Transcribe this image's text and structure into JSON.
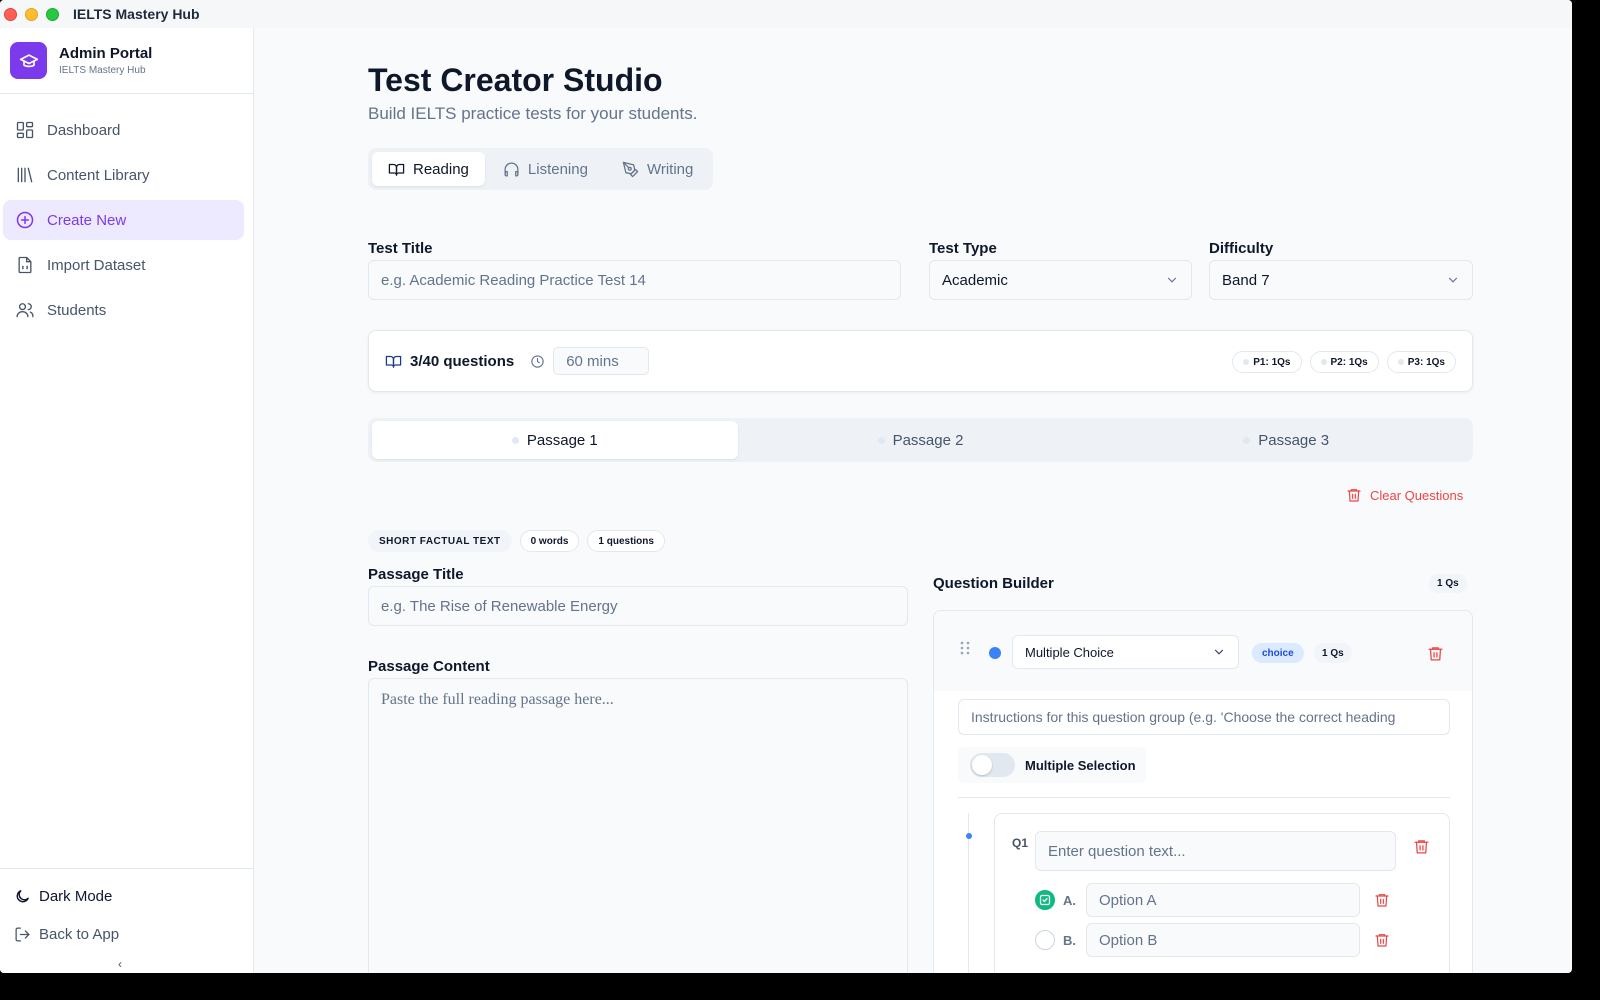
{
  "window": {
    "app_title": "IELTS Mastery Hub"
  },
  "sidebar": {
    "brand_name": "Admin Portal",
    "brand_sub": "IELTS Mastery Hub",
    "items": [
      {
        "label": "Dashboard",
        "icon": "dashboard-icon"
      },
      {
        "label": "Content Library",
        "icon": "library-icon"
      },
      {
        "label": "Create New",
        "icon": "plus-circle-icon",
        "active": true
      },
      {
        "label": "Import Dataset",
        "icon": "file-icon"
      },
      {
        "label": "Students",
        "icon": "users-icon"
      }
    ],
    "dark_mode": "Dark Mode",
    "back_to_app": "Back to App",
    "collapse": "‹"
  },
  "header": {
    "title": "Test Creator Studio",
    "subtitle": "Build IELTS practice tests for your students."
  },
  "mode_tabs": [
    {
      "label": "Reading",
      "active": true
    },
    {
      "label": "Listening"
    },
    {
      "label": "Writing"
    }
  ],
  "form": {
    "test_title_label": "Test Title",
    "test_title_placeholder": "e.g. Academic Reading Practice Test 14",
    "test_type_label": "Test Type",
    "test_type_value": "Academic",
    "difficulty_label": "Difficulty",
    "difficulty_value": "Band 7"
  },
  "stats": {
    "questions": "3/40 questions",
    "time": "60 mins",
    "pills": [
      "P1: 1Qs",
      "P2: 1Qs",
      "P3: 1Qs"
    ]
  },
  "passage_tabs": [
    {
      "label": "Passage 1",
      "active": true
    },
    {
      "label": "Passage 2"
    },
    {
      "label": "Passage 3"
    }
  ],
  "clear_questions": "Clear Questions",
  "passage": {
    "type_tag": "SHORT FACTUAL TEXT",
    "words_tag": "0 words",
    "questions_tag": "1 questions",
    "title_label": "Passage Title",
    "title_placeholder": "e.g. The Rise of Renewable Energy",
    "content_label": "Passage Content",
    "content_placeholder": "Paste the full reading passage here..."
  },
  "builder": {
    "title": "Question Builder",
    "count": "1 Qs",
    "group": {
      "type": "Multiple Choice",
      "type_tag": "choice",
      "count": "1 Qs",
      "instructions": "Instructions for this question group (e.g. 'Choose the correct heading",
      "multiple_selection": "Multiple Selection",
      "multiple_selection_on": false
    },
    "question": {
      "number": "Q1",
      "placeholder": "Enter question text...",
      "options": [
        {
          "letter": "A.",
          "placeholder": "Option A",
          "correct": true
        },
        {
          "letter": "B.",
          "placeholder": "Option B",
          "correct": false
        }
      ]
    }
  },
  "colors": {
    "accent": "#7c3aed",
    "danger": "#ef4444",
    "success": "#10b981",
    "info": "#3b82f6"
  }
}
